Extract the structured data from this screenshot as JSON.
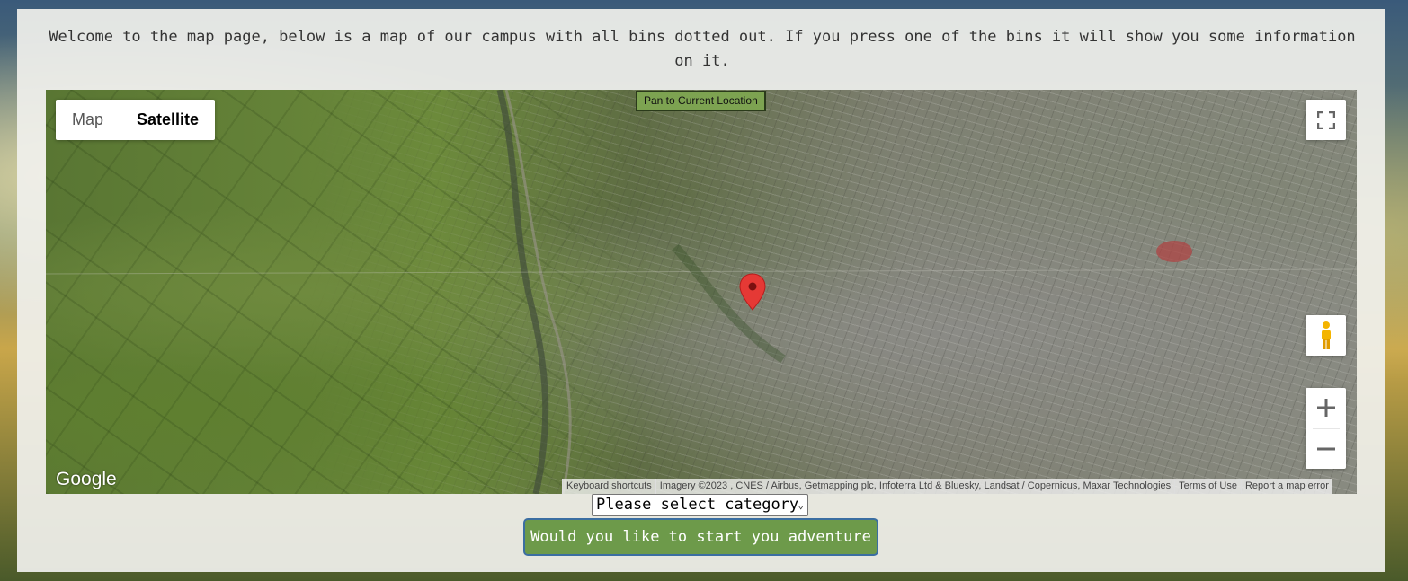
{
  "intro_text": "Welcome to the map page, below is a map of our campus with all bins dotted out. If you press one of the bins it will show you some information on it.",
  "map": {
    "map_type_options": [
      "Map",
      "Satellite"
    ],
    "selected_map_type": "Satellite",
    "pan_button": "Pan to Current Location",
    "fullscreen_icon": "fullscreen-icon",
    "pegman_icon": "street-view-pegman-icon",
    "zoom_in_icon": "plus-icon",
    "zoom_out_icon": "minus-icon",
    "marker_icon": "map-pin-icon",
    "marker_color": "#e53935",
    "logo": "Google",
    "attribution": {
      "shortcuts": "Keyboard shortcuts",
      "imagery": "Imagery ©2023 , CNES / Airbus, Getmapping plc, Infoterra Ltd & Bluesky, Landsat / Copernicus, Maxar Technologies",
      "terms": "Terms of Use",
      "report": "Report a map error"
    }
  },
  "category_select": {
    "value": "Please select category",
    "chevron_icon": "chevron-down-icon"
  },
  "adventure_button": "Would you like to start you adventure",
  "colors": {
    "button_bg": "#6d9a4a",
    "button_border": "#3b6ea1",
    "panel_bg": "#f0f0ec"
  }
}
